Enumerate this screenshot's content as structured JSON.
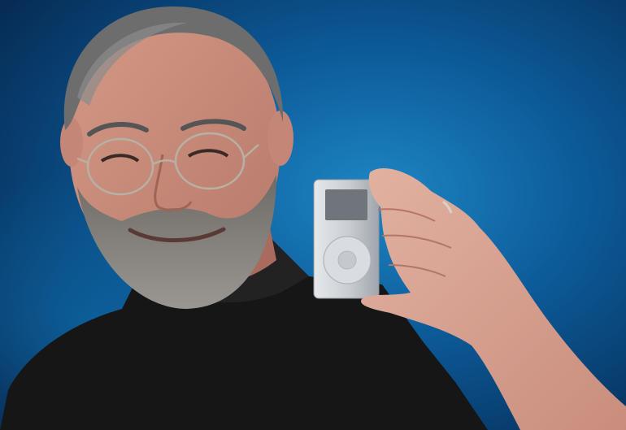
{
  "photo": {
    "subject": "person-holding-device",
    "device": "mp3-player",
    "device_color": "#c9cdd2",
    "screen_color": "#6f757b",
    "background_color": "#0a4e86",
    "shirt_color": "#1a1a1a"
  }
}
